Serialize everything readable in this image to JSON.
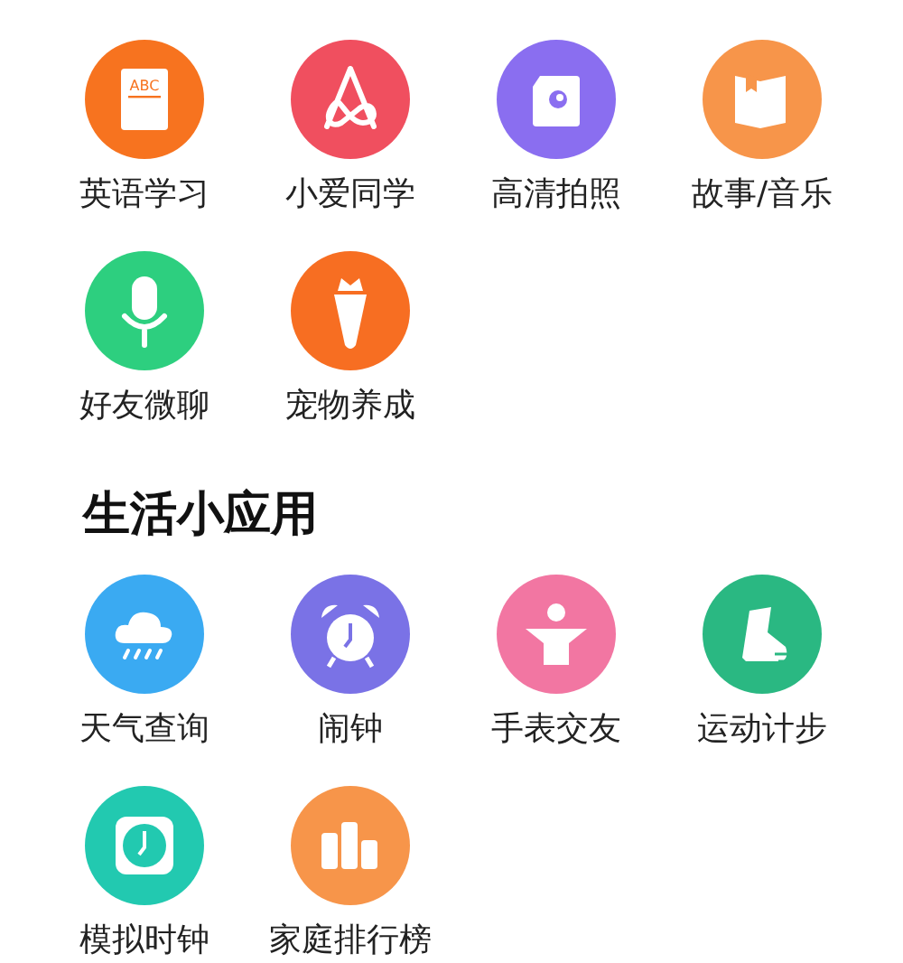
{
  "sections": [
    {
      "items": [
        {
          "label": "英语学习",
          "kind": "abc-book",
          "color": "#f7731f",
          "badge_text": "ABC"
        },
        {
          "label": "小爱同学",
          "kind": "loop",
          "color": "#f04f5f"
        },
        {
          "label": "高清拍照",
          "kind": "camera",
          "color": "#8a6ef0"
        },
        {
          "label": "故事/音乐",
          "kind": "book",
          "color": "#f7954a"
        },
        {
          "label": "好友微聊",
          "kind": "mic",
          "color": "#2dcf7f"
        },
        {
          "label": "宠物养成",
          "kind": "carrot",
          "color": "#f76e22"
        }
      ]
    },
    {
      "title": "生活小应用",
      "items": [
        {
          "label": "天气查询",
          "kind": "rain",
          "color": "#3aaaf2"
        },
        {
          "label": "闹钟",
          "kind": "alarm",
          "color": "#7a72e6"
        },
        {
          "label": "手表交友",
          "kind": "figure",
          "color": "#f276a2"
        },
        {
          "label": "运动计步",
          "kind": "shoe",
          "color": "#2ab882"
        },
        {
          "label": "模拟时钟",
          "kind": "clock",
          "color": "#22c9b0"
        },
        {
          "label": "家庭排行榜",
          "kind": "bars",
          "color": "#f7954a"
        }
      ]
    }
  ]
}
